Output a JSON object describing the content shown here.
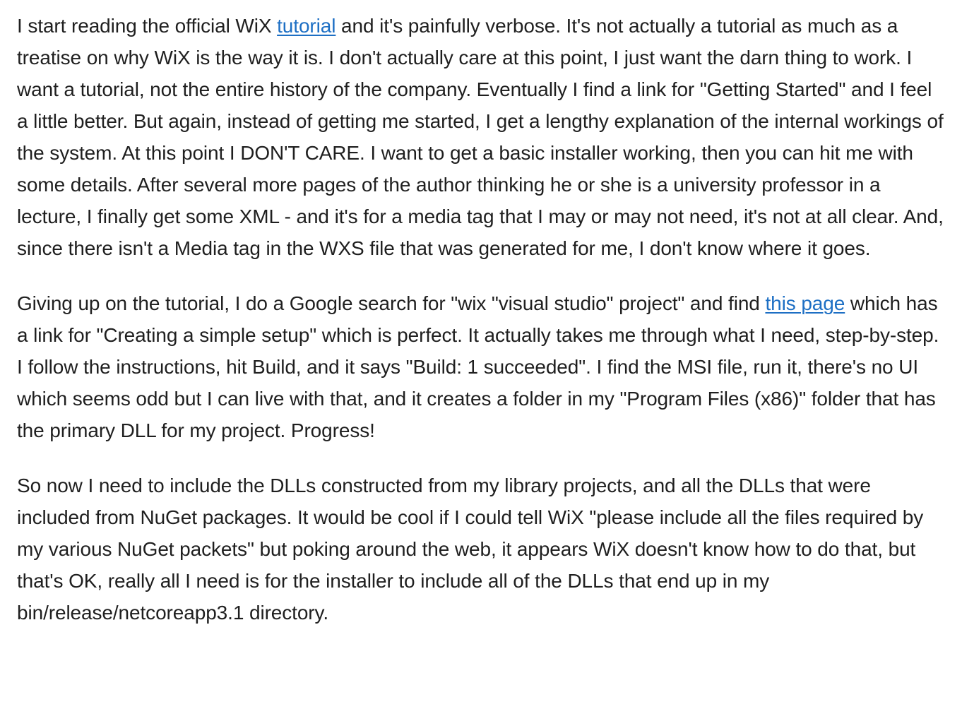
{
  "article": {
    "paragraphs": [
      {
        "before_link": "I start reading the official WiX ",
        "link_text": "tutorial",
        "after_link": " and it's painfully verbose. It's not actually a tutorial as much as a treatise on why WiX is the way it is. I don't actually care at this point, I just want the darn thing to work. I want a tutorial, not the entire history of the company. Eventually I find a link for \"Getting Started\" and I feel a little better. But again, instead of getting me started, I get a lengthy explanation of the internal workings of the system. At this point I DON'T CARE. I want to get a basic installer working, then you can hit me with some details. After several more pages of the author thinking he or she is a university professor in a lecture, I finally get some XML - and it's for a media tag that I may or may not need, it's not at all clear. And, since there isn't a Media tag in the WXS file that was generated for me, I don't know where it goes."
      },
      {
        "before_link": "Giving up on the tutorial, I do a Google search for \"wix \"visual studio\" project\" and find ",
        "link_text": "this page",
        "after_link": " which has a link for \"Creating a simple setup\" which is perfect. It actually takes me through what I need, step-by-step. I follow the instructions, hit Build, and it says \"Build: 1 succeeded\". I find the MSI file, run it, there's no UI which seems odd but I can live with that, and it creates a folder in my \"Program Files (x86)\" folder that has the primary DLL for my project. Progress!"
      },
      {
        "text": "So now I need to include the DLLs constructed from my library projects, and all the DLLs that were included from NuGet packages. It would be cool if I could tell WiX \"please include all the files required by my various NuGet packets\" but poking around the web, it appears WiX doesn't know how to do that, but that's OK, really all I need is for the installer to include all of the DLLs that end up in my bin/release/netcoreapp3.1 directory."
      }
    ]
  },
  "colors": {
    "text": "#1f1f1f",
    "link": "#1d6fc4",
    "background": "#ffffff"
  }
}
